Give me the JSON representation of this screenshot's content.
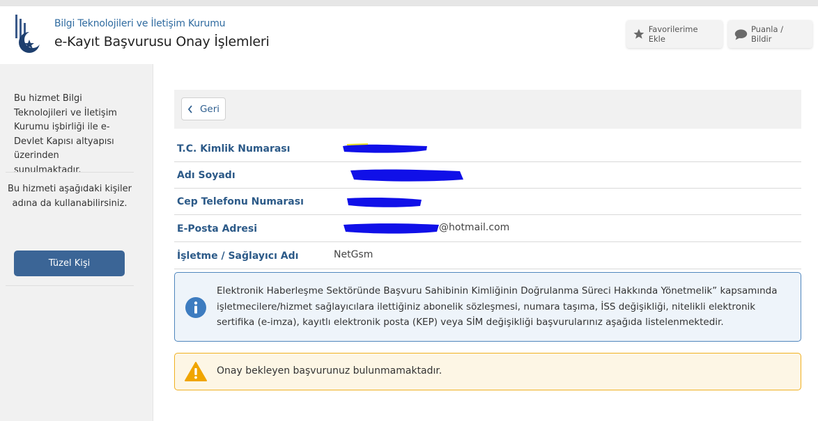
{
  "header": {
    "org_name": "Bilgi Teknolojileri ve İletişim Kurumu",
    "page_title": "e-Kayıt Başvurusu Onay İşlemleri",
    "favorites_label": "Favorilerime Ekle",
    "rate_label": "Puanla / Bildir"
  },
  "sidebar": {
    "service_note": "Bu hizmet Bilgi Teknolojileri ve İletişim Kurumu işbirliği ile e-Devlet Kapısı altyapısı üzerinden sunulmaktadır.",
    "persons_note": "Bu hizmeti aşağıdaki kişiler adına da kullanabilirsiniz.",
    "tuzel_button": "Tüzel Kişi"
  },
  "main": {
    "back_label": "Geri",
    "fields": [
      {
        "label": "T.C. Kimlik Numarası",
        "value": ""
      },
      {
        "label": "Adı Soyadı",
        "value": ""
      },
      {
        "label": "Cep Telefonu Numarası",
        "value": ""
      },
      {
        "label": "E-Posta Adresi",
        "value": "@hotmail.com"
      },
      {
        "label": "İşletme / Sağlayıcı Adı",
        "value": "NetGsm"
      }
    ],
    "info_text": "Elektronik Haberleşme Sektöründe Başvuru Sahibinin Kimliğinin Doğrulanma Süreci Hakkında Yönetmelik” kapsamında işletmecilere/hizmet sağlayıcılara ilettiğiniz abonelik sözleşmesi, numara taşıma, İSS değişikliği, nitelikli elektronik sertifika (e-imza), kayıtlı elektronik posta (KEP) veya SİM değişikliği başvurularınız aşağıda listelenmektedir.",
    "warning_text": "Onay bekleyen başvurunuz bulunmamaktadır."
  },
  "colors": {
    "accent": "#3b6596",
    "label_blue": "#2c5a88",
    "info_border": "#4f86bd",
    "warning_border": "#f0b020",
    "redaction": "#1010e8"
  },
  "icons": {
    "favorites": "star-icon",
    "rate": "speech-bubble-icon",
    "back": "chevron-left-icon",
    "info": "info-circle-icon",
    "warning": "warning-triangle-icon"
  }
}
